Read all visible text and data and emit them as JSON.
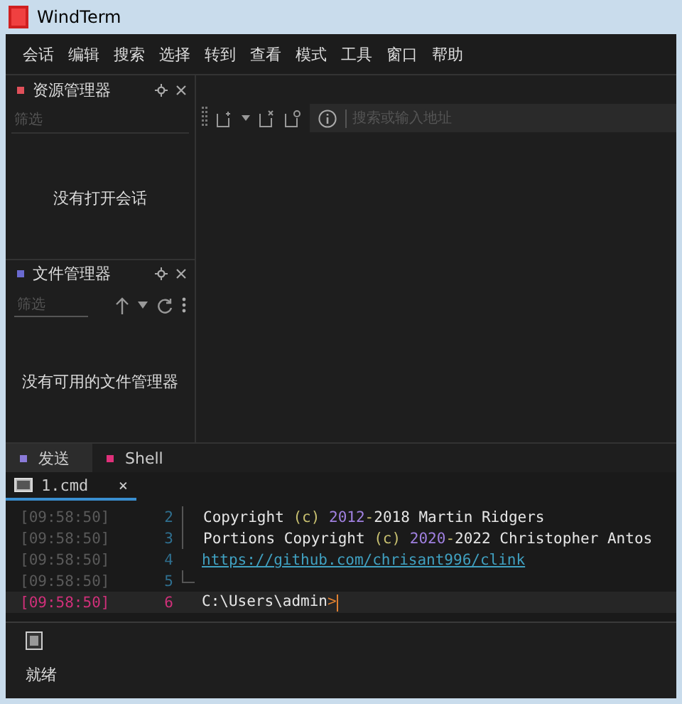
{
  "window": {
    "title": "WindTerm"
  },
  "menu": [
    "会话",
    "编辑",
    "搜索",
    "选择",
    "转到",
    "查看",
    "模式",
    "工具",
    "窗口",
    "帮助"
  ],
  "panels": [
    {
      "title": "资源管理器",
      "color": "#e0505a",
      "filter_placeholder": "筛选",
      "kind": "explorer",
      "empty_text": "没有打开会话"
    },
    {
      "title": "文件管理器",
      "color": "#6a6ad0",
      "filter_placeholder": "筛选",
      "kind": "files",
      "empty_text": "没有可用的文件管理器"
    }
  ],
  "address_bar": {
    "placeholder": "搜索或输入地址"
  },
  "bottom_tabs": [
    {
      "label": "发送",
      "color": "#8a7ad8",
      "selected": true
    },
    {
      "label": "Shell",
      "color": "#e0307a",
      "selected": false
    }
  ],
  "session_tab": {
    "label": "1.cmd",
    "close": "×",
    "selected": true
  },
  "terminal_lines": [
    {
      "time": "[09:58:50]",
      "number": "2",
      "current": false,
      "segments": [
        {
          "kind": "text",
          "text": "Copyright "
        },
        {
          "kind": "paren",
          "text": "(c)"
        },
        {
          "kind": "year",
          "text": " 2012"
        },
        {
          "kind": "paren",
          "text": "-"
        },
        {
          "kind": "text",
          "text": "2018 Martin Ridgers"
        }
      ]
    },
    {
      "time": "[09:58:50]",
      "number": "3",
      "current": false,
      "segments": [
        {
          "kind": "text",
          "text": "Portions Copyright "
        },
        {
          "kind": "paren",
          "text": "(c)"
        },
        {
          "kind": "year",
          "text": " 2020"
        },
        {
          "kind": "paren",
          "text": "-"
        },
        {
          "kind": "text",
          "text": "2022 Christopher Antos"
        }
      ]
    },
    {
      "time": "[09:58:50]",
      "number": "4",
      "current": false,
      "segments": [
        {
          "kind": "link",
          "text": "https://github.com/chrisant996/clink"
        }
      ]
    },
    {
      "time": "[09:58:50]",
      "number": "5",
      "current": false
    },
    {
      "time": "[09:58:50]",
      "number": "6",
      "current": true,
      "segments": [
        {
          "kind": "text",
          "text": "C:\\Users\\admin"
        },
        {
          "kind": "prompt",
          "text": ">"
        }
      ]
    }
  ],
  "status_bar": {
    "text": "就绪"
  }
}
